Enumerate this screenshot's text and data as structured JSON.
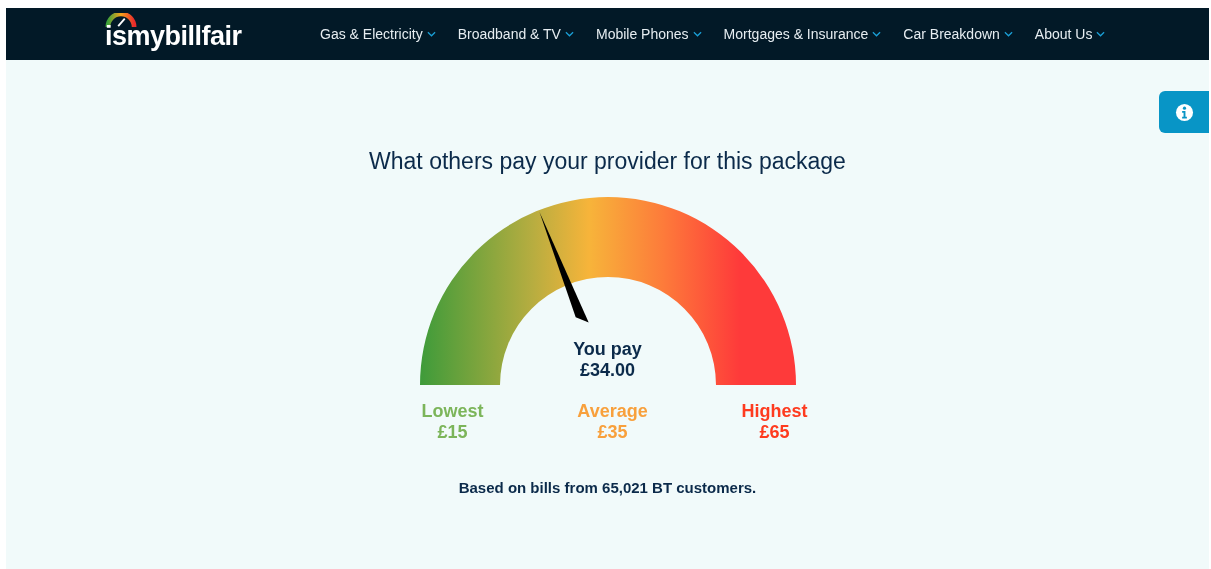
{
  "nav": {
    "logo": "ismybillfair",
    "items": [
      {
        "label": "Gas & Electricity"
      },
      {
        "label": "Broadband & TV"
      },
      {
        "label": "Mobile Phones"
      },
      {
        "label": "Mortgages & Insurance"
      },
      {
        "label": "Car Breakdown"
      },
      {
        "label": "About Us"
      }
    ]
  },
  "title": "What others pay your provider for this package",
  "gauge": {
    "level": 0.38,
    "label": "You pay",
    "amount": "£34.00",
    "scale": [
      {
        "label": "Lowest",
        "amount": "£15",
        "color": "#7cb55a"
      },
      {
        "label": "Average",
        "amount": "£35",
        "color": "#f8a03c"
      },
      {
        "label": "Highest",
        "amount": "£65",
        "color": "#fe3b1f"
      }
    ]
  },
  "footnote": "Based on bills from 65,021 BT customers."
}
